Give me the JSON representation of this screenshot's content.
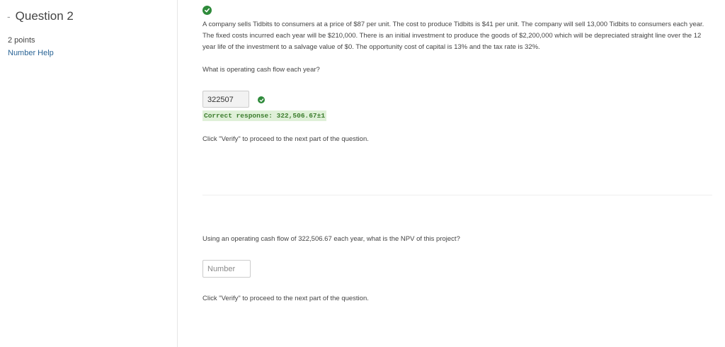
{
  "sidebar": {
    "collapse_glyph": "-",
    "question_title": "Question 2",
    "points": "2 points",
    "help_link": "Number Help"
  },
  "part1": {
    "status_icon": "check-circle-icon",
    "problem_text": "A company sells Tidbits to consumers at a price of $87 per unit. The cost to produce Tidbits is $41 per unit. The company will sell 13,000 Tidbits to consumers each year. The fixed costs incurred each year will be $210,000. There is an initial investment to produce the goods of $2,200,000 which will be depreciated straight line over the 12 year life of the investment to a salvage value of $0. The opportunity cost of capital is 13% and the tax rate is 32%.",
    "prompt": "What is operating cash flow each year?",
    "answer_value": "322507",
    "correct_response": "Correct response: 322,506.67±1",
    "verify_text": "Click \"Verify\" to proceed to the next part of the question."
  },
  "part2": {
    "prompt": "Using an operating cash flow of 322,506.67 each year, what is the NPV of this project?",
    "input_placeholder": "Number",
    "input_value": "",
    "verify_text": "Click \"Verify\" to proceed to the next part of the question."
  },
  "colors": {
    "success_green": "#2e8a3a",
    "correct_bg": "#dff0d8",
    "link_blue": "#2a6496"
  }
}
